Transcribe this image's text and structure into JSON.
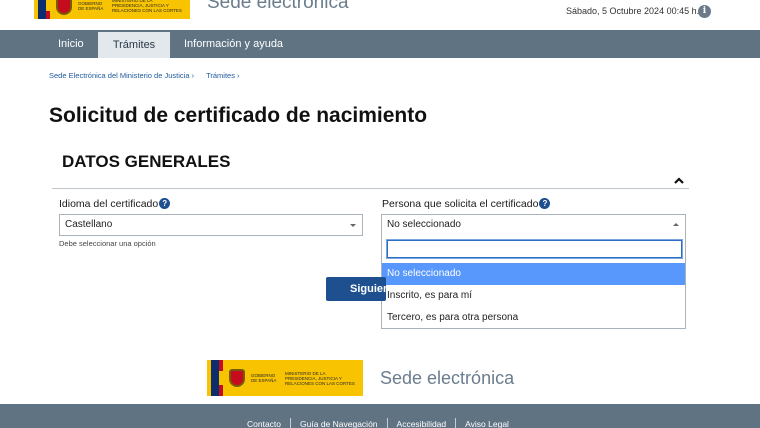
{
  "header": {
    "logo_line1": "GOBIERNO DE ESPAÑA",
    "logo_line2": "MINISTERIO DE LA PRESIDENCIA, JUSTICIA Y RELACIONES CON LAS CORTES",
    "site_title": "Sede electrónica",
    "datetime": "Sábado, 5 Octubre 2024   00:45 h.",
    "info_icon": "i"
  },
  "nav": {
    "items": [
      {
        "label": "Inicio"
      },
      {
        "label": "Trámites"
      },
      {
        "label": "Información y ayuda"
      }
    ]
  },
  "breadcrumb": {
    "items": [
      "Sede Electrónica del Ministerio de Justicia ›",
      "Trámites ›"
    ]
  },
  "page": {
    "title": "Solicitud de certificado de nacimiento",
    "section_title": "DATOS GENERALES"
  },
  "form": {
    "idioma_label": "Idioma del certificado",
    "idioma_value": "Castellano",
    "idioma_hint": "Debe seleccionar una opción",
    "persona_label": "Persona que solicita el certificado",
    "persona_value": "No seleccionado",
    "help_icon": "?",
    "persona_options": [
      {
        "label": "No seleccionado",
        "selected": true
      },
      {
        "label": "Inscrito, es para mí"
      },
      {
        "label": "Tercero, es para otra persona"
      }
    ],
    "next_button": "Siguiente"
  },
  "footer": {
    "links": [
      "Contacto",
      "Guía de Navegación",
      "Accesibilidad",
      "Aviso Legal"
    ]
  },
  "colors": {
    "nav_bg": "#5f7383",
    "primary": "#1e4f8f",
    "highlight": "#5897fb",
    "logo_yellow": "#f8c300"
  }
}
